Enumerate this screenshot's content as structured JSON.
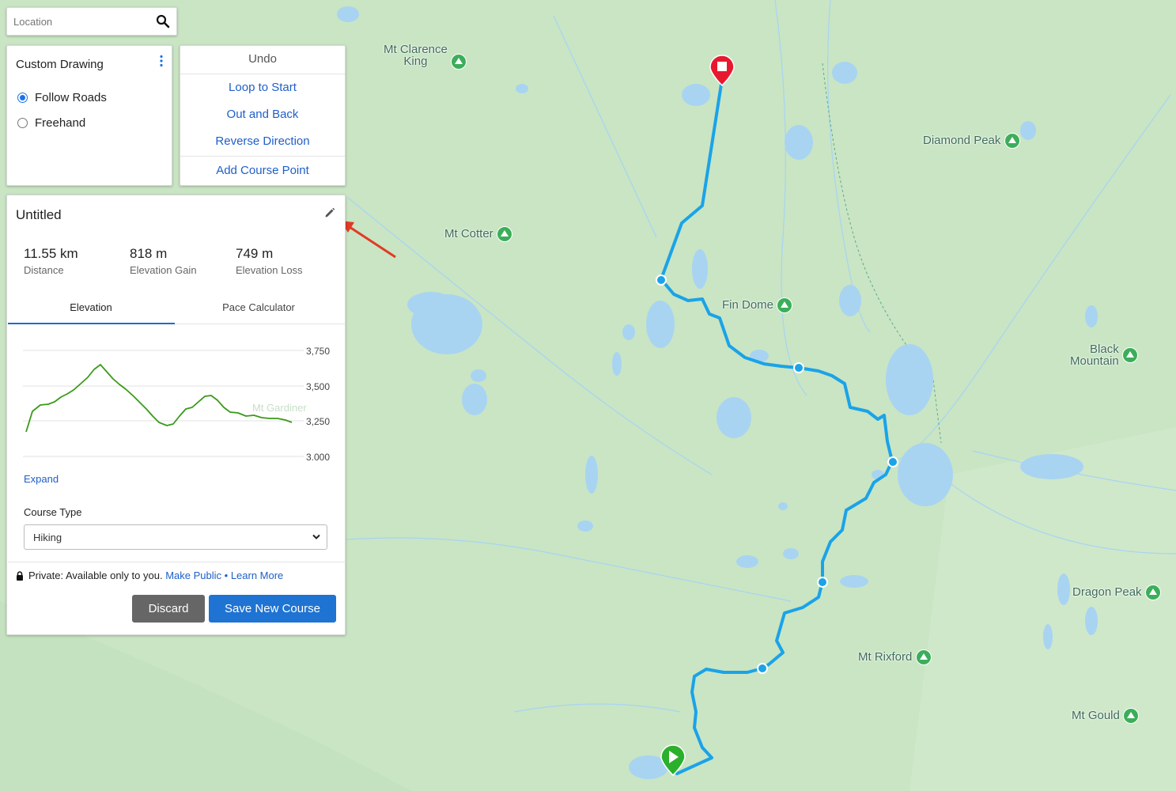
{
  "search": {
    "placeholder": "Location"
  },
  "drawing": {
    "title": "Custom Drawing",
    "options": [
      {
        "label": "Follow Roads",
        "selected": true
      },
      {
        "label": "Freehand",
        "selected": false
      }
    ]
  },
  "actions": {
    "undo": "Undo",
    "loop_to_start": "Loop to Start",
    "out_and_back": "Out and Back",
    "reverse_direction": "Reverse Direction",
    "add_course_point": "Add Course Point"
  },
  "course": {
    "title": "Untitled",
    "stats": [
      {
        "value": "11.55 km",
        "label": "Distance"
      },
      {
        "value": "818 m",
        "label": "Elevation Gain"
      },
      {
        "value": "749 m",
        "label": "Elevation Loss"
      }
    ],
    "tabs": [
      {
        "label": "Elevation",
        "active": true
      },
      {
        "label": "Pace Calculator",
        "active": false
      }
    ],
    "elevation_ticks": [
      "3,750",
      "3,500",
      "3,250",
      "3,000"
    ],
    "expand": "Expand",
    "course_type_label": "Course Type",
    "course_type_value": "Hiking",
    "privacy_text": "Private: Available only to you.",
    "make_public": "Make Public",
    "bullet": " • ",
    "learn_more": "Learn More",
    "discard": "Discard",
    "save": "Save New Course"
  },
  "map": {
    "peaks": [
      {
        "name": "Mt Clarence\nKing"
      },
      {
        "name": "Diamond Peak"
      },
      {
        "name": "Mt Cotter"
      },
      {
        "name": "Fin Dome"
      },
      {
        "name": "Black\nMountain"
      },
      {
        "name": "Dragon Peak"
      },
      {
        "name": "Mt Rixford"
      },
      {
        "name": "Mt Gould"
      },
      {
        "name": "Mt Gardiner"
      }
    ]
  },
  "colors": {
    "map_land": "#c9e5c4",
    "water": "#a8d4f2",
    "route": "#1aa3e8",
    "start_marker": "#2bb02b",
    "end_marker": "#e8192f",
    "elevation_line": "#3a9a1a",
    "primary_button": "#1f73d2"
  }
}
